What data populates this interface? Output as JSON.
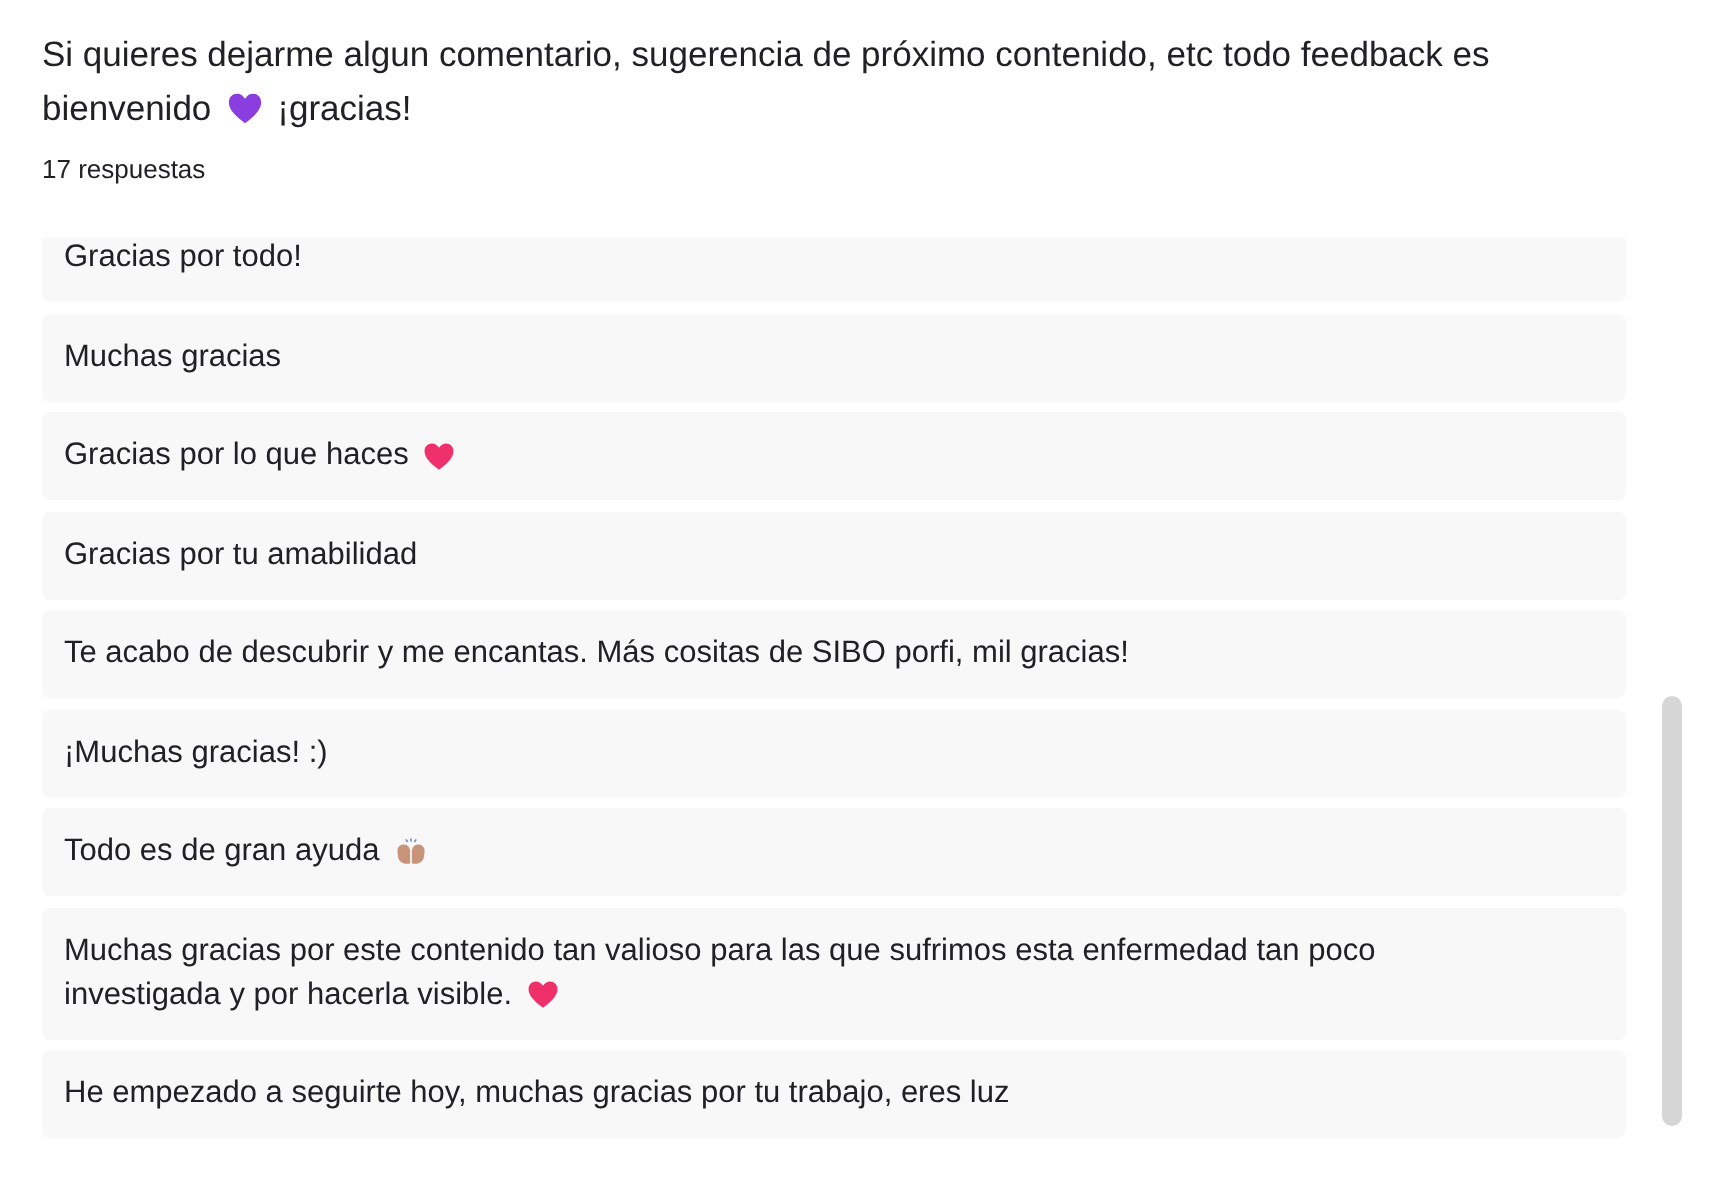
{
  "question": {
    "lines": [
      [
        {
          "kind": "text",
          "text": "Si quieres dejarme algun comentario, sugerencia de próximo contenido, etc todo feedback es"
        }
      ],
      [
        {
          "kind": "text",
          "text": "bienvenido"
        },
        {
          "kind": "heart",
          "color": "#8a3ee0"
        },
        {
          "kind": "text",
          "text": "¡gracias!"
        }
      ]
    ]
  },
  "response_count": "17 respuestas",
  "answers": [
    {
      "lines": [
        [
          {
            "kind": "text",
            "text": "Gracias por todo!"
          }
        ]
      ]
    },
    {
      "lines": [
        [
          {
            "kind": "text",
            "text": "Muchas gracias"
          }
        ]
      ]
    },
    {
      "lines": [
        [
          {
            "kind": "text",
            "text": "Gracias por lo que haces"
          },
          {
            "kind": "heart",
            "color": "#f0306a"
          }
        ]
      ]
    },
    {
      "lines": [
        [
          {
            "kind": "text",
            "text": "Gracias por tu amabilidad"
          }
        ]
      ]
    },
    {
      "lines": [
        [
          {
            "kind": "text",
            "text": "Te acabo de descubrir y me encantas. Más cositas de SIBO porfi, mil gracias!"
          }
        ]
      ]
    },
    {
      "lines": [
        [
          {
            "kind": "text",
            "text": "¡Muchas gracias! :)"
          }
        ]
      ]
    },
    {
      "lines": [
        [
          {
            "kind": "text",
            "text": "Todo es de gran ayuda"
          },
          {
            "kind": "hands"
          }
        ]
      ]
    },
    {
      "lines": [
        [
          {
            "kind": "text",
            "text": "Muchas gracias por este contenido tan valioso para las que sufrimos esta enfermedad tan poco"
          }
        ],
        [
          {
            "kind": "text",
            "text": "investigada y por hacerla visible."
          },
          {
            "kind": "heart",
            "color": "#f0306a"
          }
        ]
      ]
    },
    {
      "lines": [
        [
          {
            "kind": "text",
            "text": "He empezado a seguirte hoy, muchas gracias por tu trabajo, eres luz"
          }
        ]
      ]
    }
  ]
}
